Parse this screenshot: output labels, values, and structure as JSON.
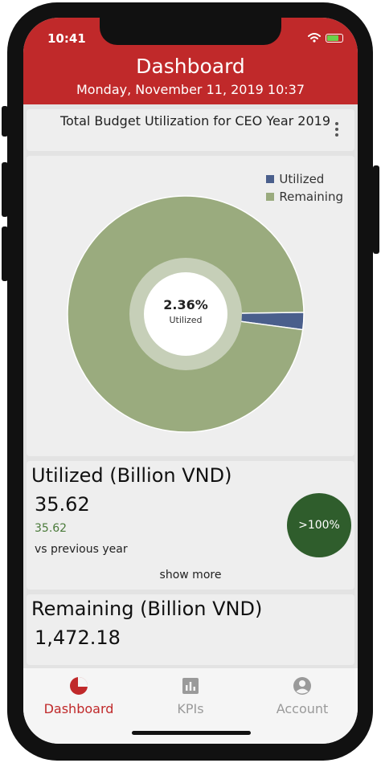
{
  "status_bar": {
    "time": "10:41"
  },
  "header": {
    "title": "Dashboard",
    "subtitle": "Monday, November 11, 2019 10:37"
  },
  "budget_card": {
    "title": "Total Budget Utilization for CEO Year 2019",
    "menu_icon": "kebab-menu-icon"
  },
  "chart_data": {
    "type": "pie",
    "subtype": "donut",
    "labels": [
      "Utilized",
      "Remaining"
    ],
    "values": [
      2.36,
      97.64
    ],
    "colors": [
      "#4a5f8c",
      "#9aab7e"
    ],
    "center_value": "2.36%",
    "center_label": "Utilized",
    "legend_position": "top-right"
  },
  "utilized": {
    "heading": "Utilized (Billion VND)",
    "value": "35.62",
    "previous_value": "35.62",
    "comparison_label": "vs previous year",
    "growth_badge": ">100%",
    "show_more": "show more",
    "badge_color": "#2f5d2c"
  },
  "remaining": {
    "heading": "Remaining (Billion VND)",
    "value": "1,472.18"
  },
  "tabs": [
    {
      "label": "Dashboard",
      "icon": "dashboard-pie-icon",
      "active": true
    },
    {
      "label": "KPIs",
      "icon": "bar-chart-icon",
      "active": false
    },
    {
      "label": "Account",
      "icon": "account-circle-icon",
      "active": false
    }
  ],
  "colors": {
    "brand_red": "#c0292a",
    "tab_inactive": "#9a9a9a",
    "screen_bg": "#e3e3e3",
    "card_bg": "#eeeeee"
  }
}
